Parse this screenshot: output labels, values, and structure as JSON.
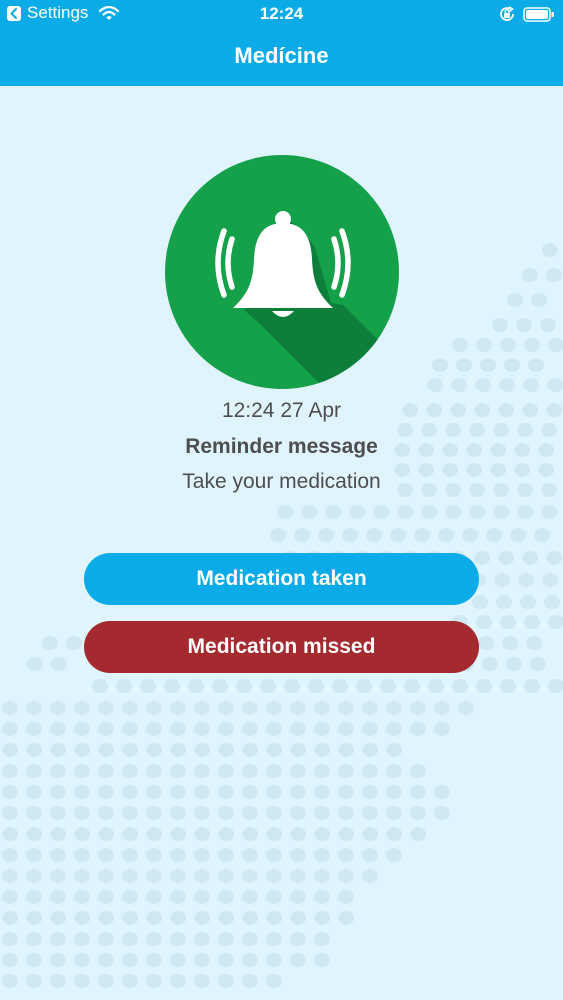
{
  "status_bar": {
    "back_app": "Settings",
    "time": "12:24",
    "icons": [
      "back-arrow-icon",
      "wifi-icon",
      "orientation-lock-icon",
      "battery-icon"
    ]
  },
  "nav": {
    "title": "Medícine"
  },
  "reminder": {
    "icon": "bell-ringing-icon",
    "icon_bg_color": "#15a04a",
    "datetime": "12:24 27 Apr",
    "title": "Reminder message",
    "message": "Take your medication"
  },
  "actions": {
    "taken_label": "Medication taken",
    "taken_color": "#0aabe6",
    "missed_label": "Medication missed",
    "missed_color": "#a42a30"
  },
  "colors": {
    "brand": "#0aabe6",
    "background": "#dff4fc",
    "text": "#4e4e50"
  }
}
